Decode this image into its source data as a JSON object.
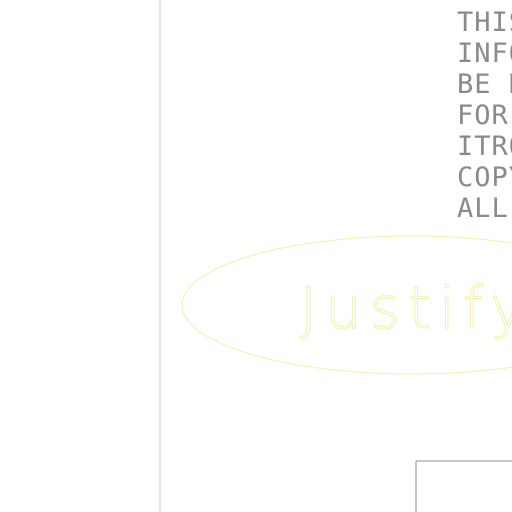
{
  "colors": {
    "background": "#ffffff",
    "border_line": "#c8c8c8",
    "note_text": "#8a8a8a",
    "stamp_outline": "#f3f0a8",
    "title_block": "#8f8f8f"
  },
  "copyright_note": {
    "lines": [
      "THIS I",
      "INFORM",
      "BE DUP",
      "FOR AN",
      "ITRON",
      "COPYR",
      "ALL RI"
    ]
  },
  "stamp": {
    "text": "Justify"
  }
}
